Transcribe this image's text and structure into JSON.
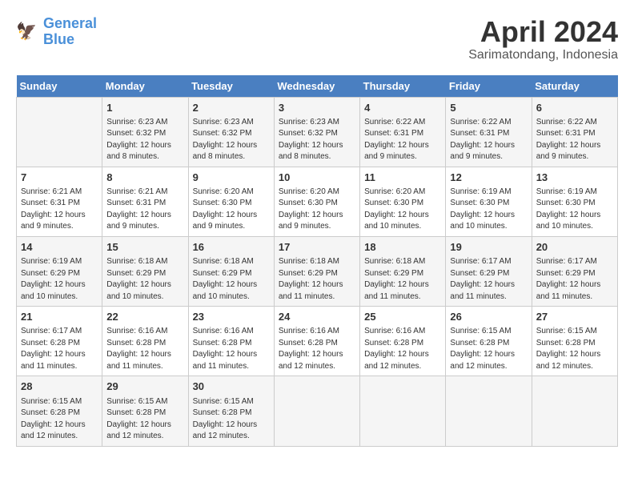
{
  "header": {
    "logo_line1": "General",
    "logo_line2": "Blue",
    "title": "April 2024",
    "subtitle": "Sarimatondang, Indonesia"
  },
  "days_of_week": [
    "Sunday",
    "Monday",
    "Tuesday",
    "Wednesday",
    "Thursday",
    "Friday",
    "Saturday"
  ],
  "weeks": [
    [
      {
        "day": "",
        "info": ""
      },
      {
        "day": "1",
        "info": "Sunrise: 6:23 AM\nSunset: 6:32 PM\nDaylight: 12 hours\nand 8 minutes."
      },
      {
        "day": "2",
        "info": "Sunrise: 6:23 AM\nSunset: 6:32 PM\nDaylight: 12 hours\nand 8 minutes."
      },
      {
        "day": "3",
        "info": "Sunrise: 6:23 AM\nSunset: 6:32 PM\nDaylight: 12 hours\nand 8 minutes."
      },
      {
        "day": "4",
        "info": "Sunrise: 6:22 AM\nSunset: 6:31 PM\nDaylight: 12 hours\nand 9 minutes."
      },
      {
        "day": "5",
        "info": "Sunrise: 6:22 AM\nSunset: 6:31 PM\nDaylight: 12 hours\nand 9 minutes."
      },
      {
        "day": "6",
        "info": "Sunrise: 6:22 AM\nSunset: 6:31 PM\nDaylight: 12 hours\nand 9 minutes."
      }
    ],
    [
      {
        "day": "7",
        "info": "Sunrise: 6:21 AM\nSunset: 6:31 PM\nDaylight: 12 hours\nand 9 minutes."
      },
      {
        "day": "8",
        "info": "Sunrise: 6:21 AM\nSunset: 6:31 PM\nDaylight: 12 hours\nand 9 minutes."
      },
      {
        "day": "9",
        "info": "Sunrise: 6:20 AM\nSunset: 6:30 PM\nDaylight: 12 hours\nand 9 minutes."
      },
      {
        "day": "10",
        "info": "Sunrise: 6:20 AM\nSunset: 6:30 PM\nDaylight: 12 hours\nand 9 minutes."
      },
      {
        "day": "11",
        "info": "Sunrise: 6:20 AM\nSunset: 6:30 PM\nDaylight: 12 hours\nand 10 minutes."
      },
      {
        "day": "12",
        "info": "Sunrise: 6:19 AM\nSunset: 6:30 PM\nDaylight: 12 hours\nand 10 minutes."
      },
      {
        "day": "13",
        "info": "Sunrise: 6:19 AM\nSunset: 6:30 PM\nDaylight: 12 hours\nand 10 minutes."
      }
    ],
    [
      {
        "day": "14",
        "info": "Sunrise: 6:19 AM\nSunset: 6:29 PM\nDaylight: 12 hours\nand 10 minutes."
      },
      {
        "day": "15",
        "info": "Sunrise: 6:18 AM\nSunset: 6:29 PM\nDaylight: 12 hours\nand 10 minutes."
      },
      {
        "day": "16",
        "info": "Sunrise: 6:18 AM\nSunset: 6:29 PM\nDaylight: 12 hours\nand 10 minutes."
      },
      {
        "day": "17",
        "info": "Sunrise: 6:18 AM\nSunset: 6:29 PM\nDaylight: 12 hours\nand 11 minutes."
      },
      {
        "day": "18",
        "info": "Sunrise: 6:18 AM\nSunset: 6:29 PM\nDaylight: 12 hours\nand 11 minutes."
      },
      {
        "day": "19",
        "info": "Sunrise: 6:17 AM\nSunset: 6:29 PM\nDaylight: 12 hours\nand 11 minutes."
      },
      {
        "day": "20",
        "info": "Sunrise: 6:17 AM\nSunset: 6:29 PM\nDaylight: 12 hours\nand 11 minutes."
      }
    ],
    [
      {
        "day": "21",
        "info": "Sunrise: 6:17 AM\nSunset: 6:28 PM\nDaylight: 12 hours\nand 11 minutes."
      },
      {
        "day": "22",
        "info": "Sunrise: 6:16 AM\nSunset: 6:28 PM\nDaylight: 12 hours\nand 11 minutes."
      },
      {
        "day": "23",
        "info": "Sunrise: 6:16 AM\nSunset: 6:28 PM\nDaylight: 12 hours\nand 11 minutes."
      },
      {
        "day": "24",
        "info": "Sunrise: 6:16 AM\nSunset: 6:28 PM\nDaylight: 12 hours\nand 12 minutes."
      },
      {
        "day": "25",
        "info": "Sunrise: 6:16 AM\nSunset: 6:28 PM\nDaylight: 12 hours\nand 12 minutes."
      },
      {
        "day": "26",
        "info": "Sunrise: 6:15 AM\nSunset: 6:28 PM\nDaylight: 12 hours\nand 12 minutes."
      },
      {
        "day": "27",
        "info": "Sunrise: 6:15 AM\nSunset: 6:28 PM\nDaylight: 12 hours\nand 12 minutes."
      }
    ],
    [
      {
        "day": "28",
        "info": "Sunrise: 6:15 AM\nSunset: 6:28 PM\nDaylight: 12 hours\nand 12 minutes."
      },
      {
        "day": "29",
        "info": "Sunrise: 6:15 AM\nSunset: 6:28 PM\nDaylight: 12 hours\nand 12 minutes."
      },
      {
        "day": "30",
        "info": "Sunrise: 6:15 AM\nSunset: 6:28 PM\nDaylight: 12 hours\nand 12 minutes."
      },
      {
        "day": "",
        "info": ""
      },
      {
        "day": "",
        "info": ""
      },
      {
        "day": "",
        "info": ""
      },
      {
        "day": "",
        "info": ""
      }
    ]
  ]
}
